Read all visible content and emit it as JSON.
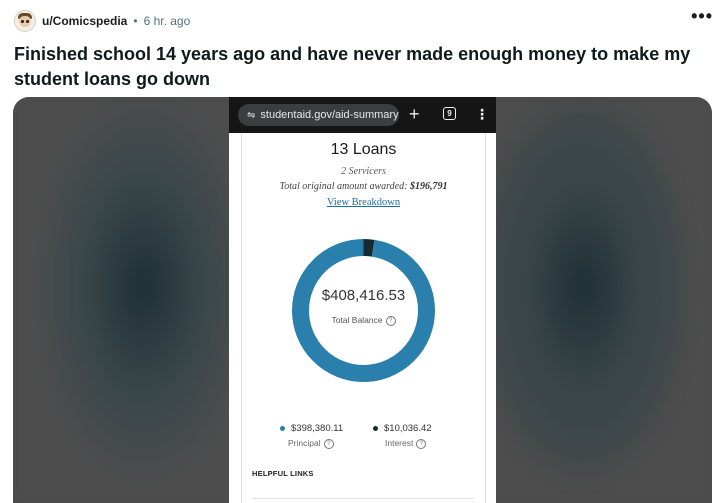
{
  "post": {
    "username": "u/Comicspedia",
    "separator": "•",
    "timestamp": "6 hr. ago",
    "more_icon": "•••",
    "title": "Finished school 14 years ago and have never made enough money to make my student loans go down"
  },
  "browser": {
    "url": "studentaid.gov/aid-summary",
    "tune_icon": "⇋",
    "plus_icon": "+",
    "tabs_count": "9",
    "kebab_icon": "⋮"
  },
  "summary": {
    "loans_title": "13 Loans",
    "servicers": "2 Servicers",
    "awarded_label": "Total original amount awarded: ",
    "awarded_value": "$196,791",
    "breakdown_link": "View Breakdown",
    "balance_amount": "$408,416.53",
    "balance_label": "Total Balance",
    "principal_value": "$398,380.11",
    "principal_label": "Principal",
    "interest_value": "$10,036.42",
    "interest_label": "Interest",
    "help_icon": "?",
    "helpful_links": "HELPFUL LINKS"
  },
  "colors": {
    "principal": "#2a7fad",
    "interest": "#152a33"
  },
  "chart_data": {
    "type": "pie",
    "donut": true,
    "categories": [
      "Principal",
      "Interest"
    ],
    "values": [
      398380.11,
      10036.42
    ]
  }
}
